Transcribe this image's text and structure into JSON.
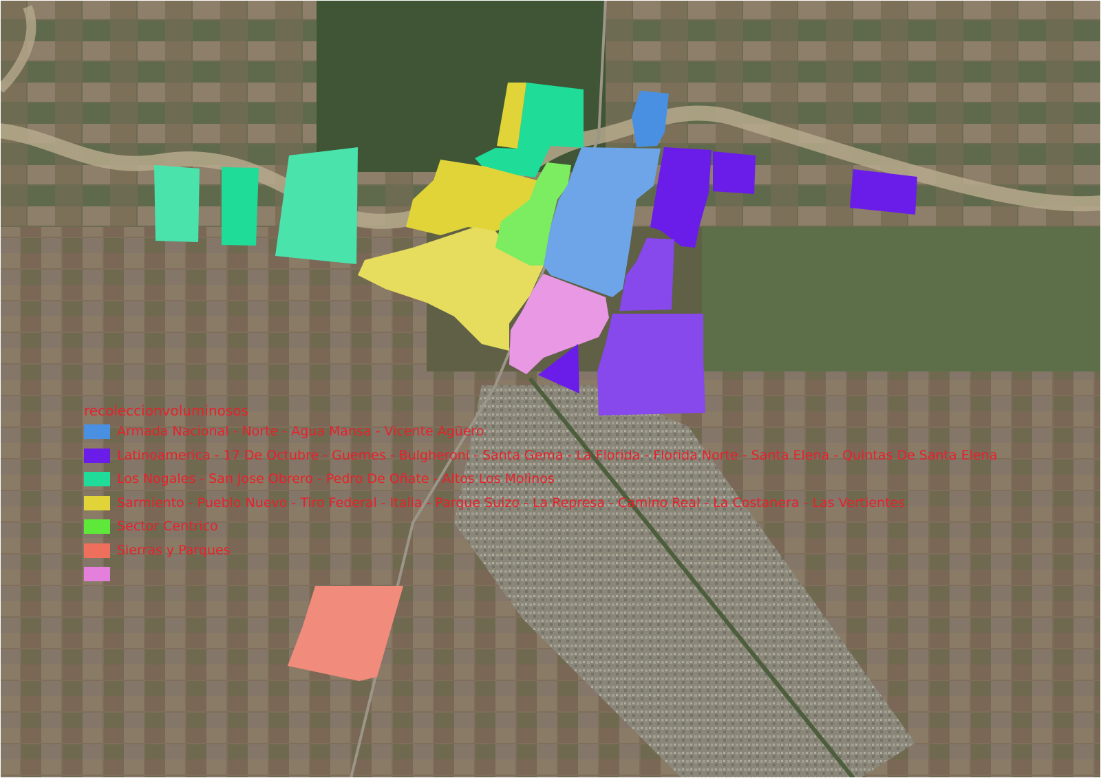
{
  "legend": {
    "title": "recoleccionvoluminosos",
    "items": [
      {
        "label": "Armada Nacional - Norte - Agua Mansa - Vicente Agüero",
        "color": "#4a90e2"
      },
      {
        "label": "Latinoamerica - 17 De Octubre - Guemes - Bulgheroni - Santa Gema - La Florida - Florida Norte - Santa Elena - Quintas De Santa Elena",
        "color": "#6a1de8"
      },
      {
        "label": "Los Nogales - San Jose Obrero - Pedro De Oñate - Altos Los Molinos",
        "color": "#1fdc98"
      },
      {
        "label": "Sarmiento - Pueblo Nuevo - Tiro Federal - Italia - Parque Suizo - La Represa - Camino Real - La Costanera - Las Vertientes",
        "color": "#e0d438"
      },
      {
        "label": "Sector Centrico",
        "color": "#5de83a"
      },
      {
        "label": "Sierras y Parques",
        "color": "#ee6f5c"
      },
      {
        "label": "",
        "color": "#e47fdc"
      }
    ]
  },
  "colors": {
    "blue": "#4a90e2",
    "purple": "#6a1de8",
    "teal": "#1fdc98",
    "yellow": "#e0d438",
    "green": "#5de83a",
    "salmon": "#ee6f5c",
    "pink": "#e47fdc",
    "legend_text": "#e8202a"
  }
}
